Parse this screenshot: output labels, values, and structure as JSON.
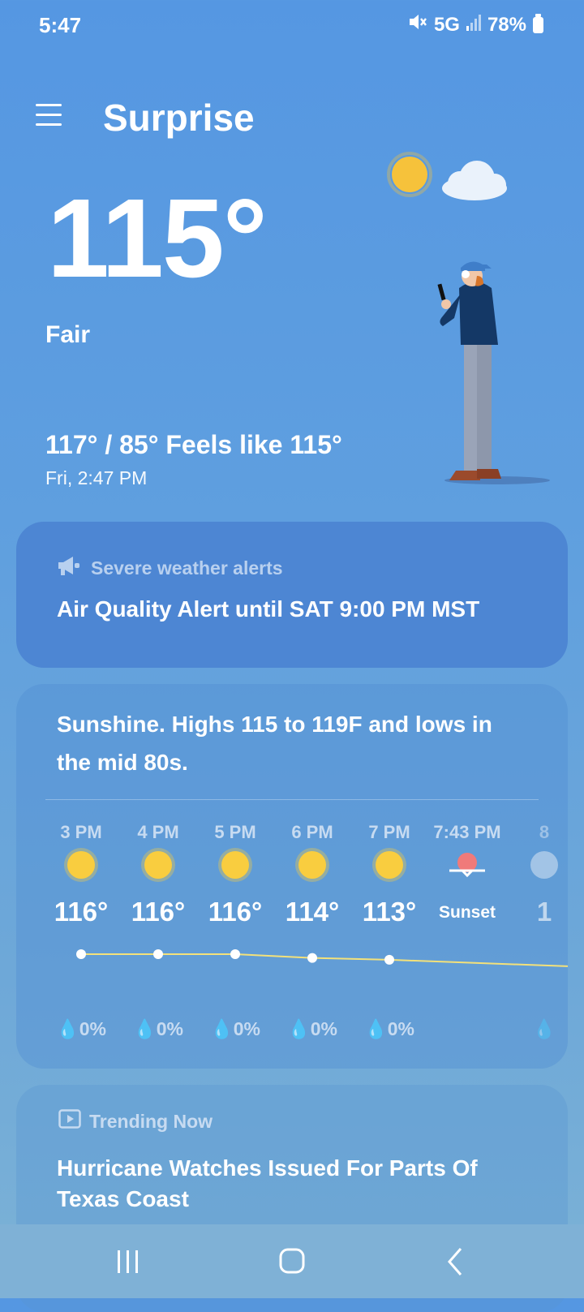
{
  "status_bar": {
    "time": "5:47",
    "network": "5G",
    "battery": "78%",
    "icons": [
      "mute-icon",
      "signal-icon",
      "battery-icon"
    ]
  },
  "header": {
    "menu_icon": "hamburger-menu-icon",
    "city": "Surprise"
  },
  "current": {
    "temperature": "115°",
    "condition": "Fair",
    "high_low_feels": "117° / 85° Feels like 115°",
    "datetime": "Fri, 2:47 PM"
  },
  "alert": {
    "icon": "megaphone-icon",
    "heading": "Severe weather alerts",
    "text": "Air Quality Alert until SAT 9:00 PM MST"
  },
  "forecast": {
    "summary": "Sunshine. Highs 115 to 119F and lows in the mid 80s.",
    "hours": [
      {
        "time": "3 PM",
        "icon": "sun-icon",
        "temp": "116°",
        "precip": "0%"
      },
      {
        "time": "4 PM",
        "icon": "sun-icon",
        "temp": "116°",
        "precip": "0%"
      },
      {
        "time": "5 PM",
        "icon": "sun-icon",
        "temp": "116°",
        "precip": "0%"
      },
      {
        "time": "6 PM",
        "icon": "sun-icon",
        "temp": "114°",
        "precip": "0%"
      },
      {
        "time": "7 PM",
        "icon": "sun-icon",
        "temp": "113°",
        "precip": "0%"
      },
      {
        "time": "7:43 PM",
        "icon": "sunset-icon",
        "label": "Sunset"
      },
      {
        "time": "8",
        "icon": "moon-icon",
        "temp": "1",
        "precip": ""
      }
    ],
    "trend_values": [
      116,
      116,
      116,
      114,
      113
    ],
    "colors": {
      "sun": "#f9cd3f",
      "sunset": "#f07a7a",
      "line": "#f3e17a"
    }
  },
  "trending": {
    "icon": "play-icon",
    "heading": "Trending Now",
    "title": "Hurricane Watches Issued For Parts Of Texas Coast"
  },
  "nav_bar": {
    "buttons": [
      "recent-apps-icon",
      "home-icon",
      "back-icon"
    ]
  }
}
